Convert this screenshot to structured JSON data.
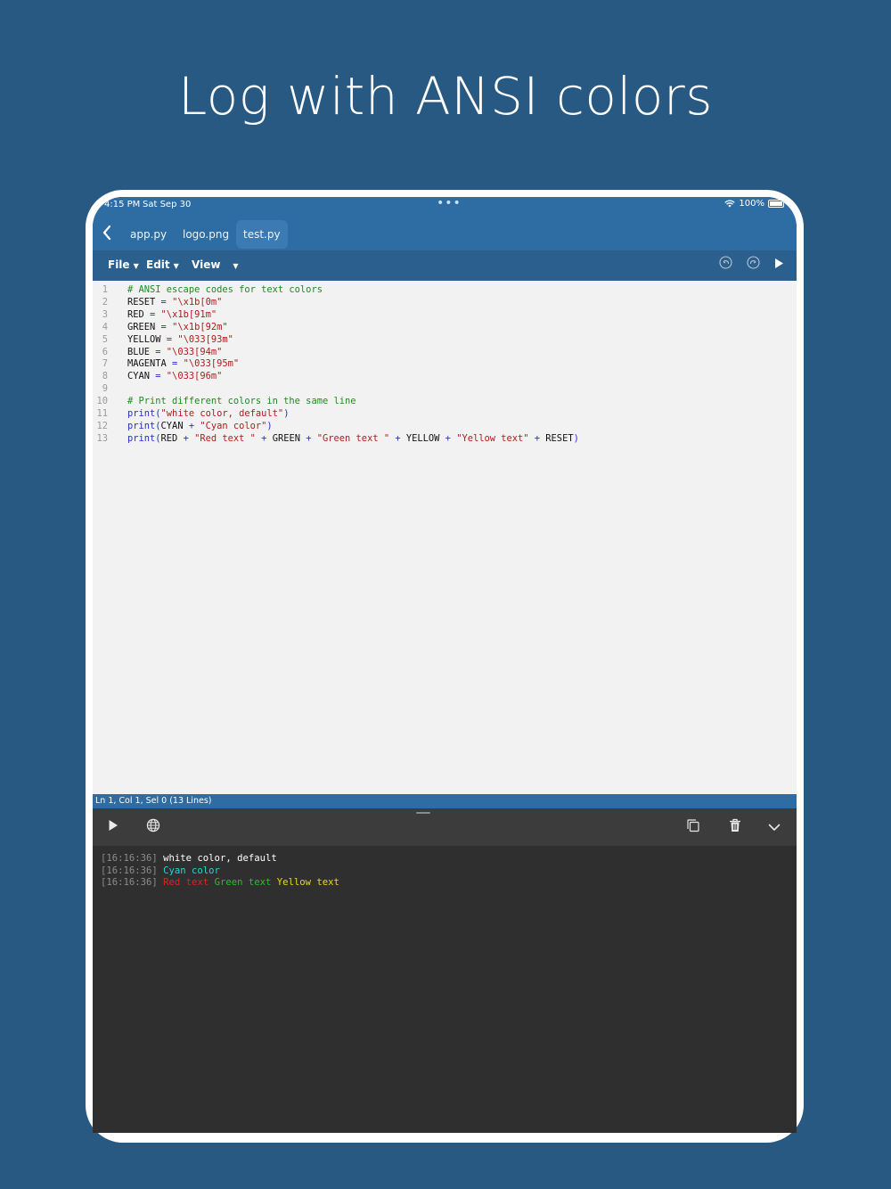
{
  "headline": "Log with ANSI colors",
  "status": {
    "time": "4:15 PM",
    "date": "Sat Sep 30",
    "dots": "•••",
    "battery": "100%"
  },
  "tabs": [
    {
      "label": "app.py",
      "active": false
    },
    {
      "label": "logo.png",
      "active": false
    },
    {
      "label": "test.py",
      "active": true
    }
  ],
  "menu": {
    "file": "File",
    "edit": "Edit",
    "view": "View"
  },
  "editor": {
    "line_numbers": [
      "1",
      "2",
      "3",
      "4",
      "5",
      "6",
      "7",
      "8",
      "9",
      "10",
      "11",
      "12",
      "13"
    ],
    "lines": [
      [
        {
          "t": "# ANSI escape codes for text colors",
          "c": "com"
        }
      ],
      [
        {
          "t": "RESET ",
          "c": "id"
        },
        {
          "t": "=",
          "c": "op"
        },
        {
          "t": " \"\\x1b[0m\"",
          "c": "str"
        }
      ],
      [
        {
          "t": "RED ",
          "c": "id"
        },
        {
          "t": "=",
          "c": "op"
        },
        {
          "t": " \"\\x1b[91m\"",
          "c": "str"
        }
      ],
      [
        {
          "t": "GREEN ",
          "c": "id"
        },
        {
          "t": "=",
          "c": "op"
        },
        {
          "t": " \"\\x1b[92m\"",
          "c": "str"
        }
      ],
      [
        {
          "t": "YELLOW ",
          "c": "id"
        },
        {
          "t": "=",
          "c": "op"
        },
        {
          "t": " \"\\033[93m\"",
          "c": "str"
        }
      ],
      [
        {
          "t": "BLUE ",
          "c": "id"
        },
        {
          "t": "=",
          "c": "op"
        },
        {
          "t": " \"\\033[94m\"",
          "c": "str"
        }
      ],
      [
        {
          "t": "MAGENTA ",
          "c": "id"
        },
        {
          "t": "=",
          "c": "op"
        },
        {
          "t": " \"\\033[95m\"",
          "c": "str"
        }
      ],
      [
        {
          "t": "CYAN ",
          "c": "id"
        },
        {
          "t": "=",
          "c": "op"
        },
        {
          "t": " \"\\033[96m\"",
          "c": "str"
        }
      ],
      [],
      [
        {
          "t": "# Print different colors in the same line",
          "c": "com"
        }
      ],
      [
        {
          "t": "print",
          "c": "kw"
        },
        {
          "t": "(",
          "c": "op"
        },
        {
          "t": "\"white color, default\"",
          "c": "str"
        },
        {
          "t": ")",
          "c": "op"
        }
      ],
      [
        {
          "t": "print",
          "c": "kw"
        },
        {
          "t": "(",
          "c": "op"
        },
        {
          "t": "CYAN ",
          "c": "id"
        },
        {
          "t": "+ ",
          "c": "op"
        },
        {
          "t": "\"Cyan color\"",
          "c": "str"
        },
        {
          "t": ")",
          "c": "op"
        }
      ],
      [
        {
          "t": "print",
          "c": "kw"
        },
        {
          "t": "(",
          "c": "op"
        },
        {
          "t": "RED ",
          "c": "id"
        },
        {
          "t": "+ ",
          "c": "op"
        },
        {
          "t": "\"Red text \"",
          "c": "str"
        },
        {
          "t": " + ",
          "c": "op"
        },
        {
          "t": "GREEN ",
          "c": "id"
        },
        {
          "t": "+ ",
          "c": "op"
        },
        {
          "t": "\"Green text \"",
          "c": "str"
        },
        {
          "t": " + ",
          "c": "op"
        },
        {
          "t": "YELLOW ",
          "c": "id"
        },
        {
          "t": "+ ",
          "c": "op"
        },
        {
          "t": "\"Yellow text\"",
          "c": "str"
        },
        {
          "t": " + ",
          "c": "op"
        },
        {
          "t": "RESET",
          "c": "id"
        },
        {
          "t": ")",
          "c": "op"
        }
      ]
    ]
  },
  "statusbar": "Ln 1, Col 1, Sel 0 (13 Lines)",
  "console": {
    "logs": [
      {
        "ts": "[16:16:36]",
        "parts": [
          {
            "t": " white color, default",
            "color": "#ffffff"
          }
        ]
      },
      {
        "ts": "[16:16:36]",
        "parts": [
          {
            "t": " Cyan color",
            "color": "#2fd0d8"
          }
        ]
      },
      {
        "ts": "[16:16:36]",
        "parts": [
          {
            "t": " Red text ",
            "color": "#e02020"
          },
          {
            "t": "Green text ",
            "color": "#25c22a"
          },
          {
            "t": "Yellow text",
            "color": "#e8d81c"
          }
        ]
      }
    ]
  },
  "colors": {
    "background": "#285983",
    "toolbar": "#2e6da4",
    "editor_bg": "#f2f2f2",
    "console_bg": "#2f2f2f"
  }
}
